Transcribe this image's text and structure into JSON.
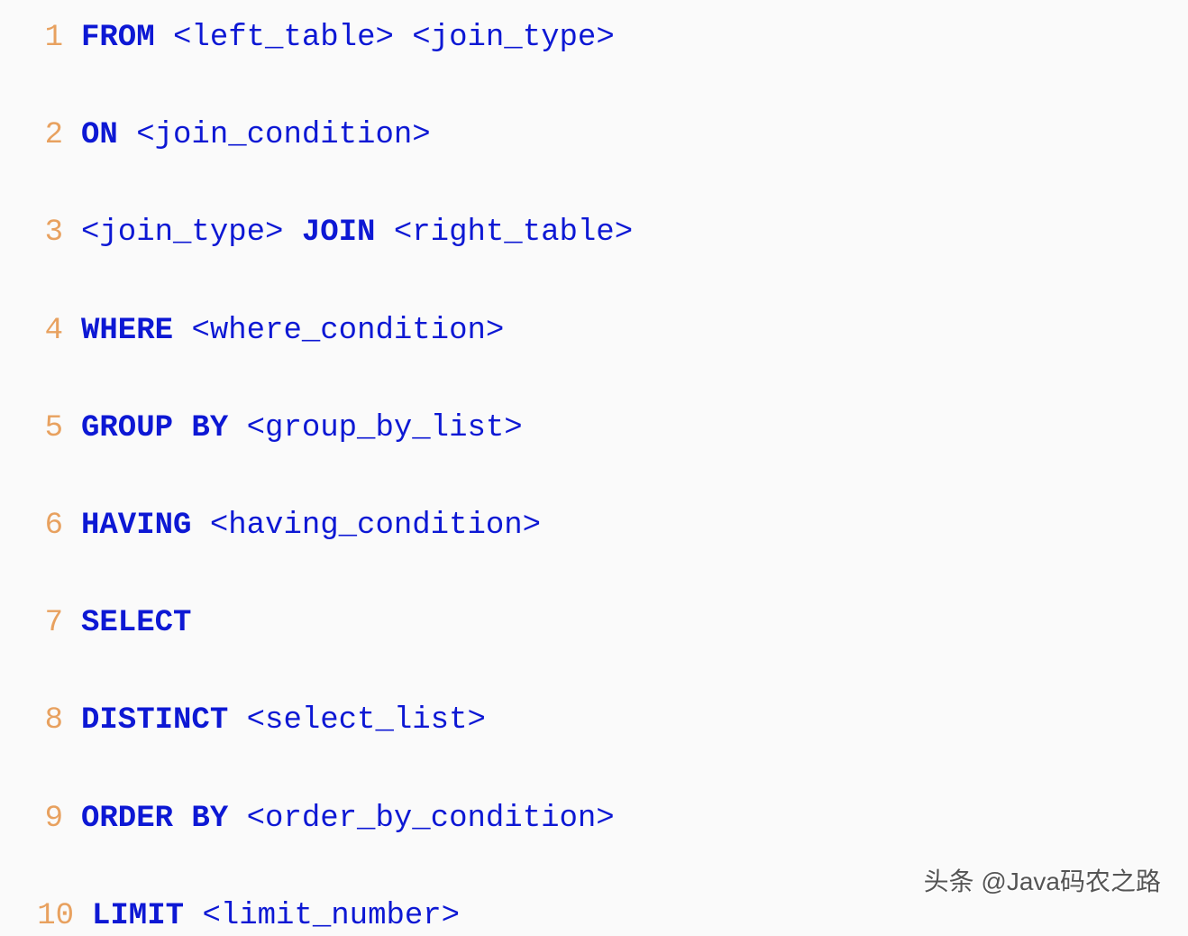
{
  "code": {
    "lines": [
      {
        "number": "1",
        "tokens": [
          {
            "type": "keyword",
            "text": "FROM"
          },
          {
            "type": "space",
            "text": " "
          },
          {
            "type": "placeholder",
            "text": "<left_table>"
          },
          {
            "type": "space",
            "text": " "
          },
          {
            "type": "placeholder",
            "text": "<join_type>"
          }
        ]
      },
      {
        "number": "2",
        "tokens": [
          {
            "type": "keyword",
            "text": "ON"
          },
          {
            "type": "space",
            "text": " "
          },
          {
            "type": "placeholder",
            "text": "<join_condition>"
          }
        ]
      },
      {
        "number": "3",
        "tokens": [
          {
            "type": "placeholder",
            "text": "<join_type>"
          },
          {
            "type": "space",
            "text": " "
          },
          {
            "type": "keyword",
            "text": "JOIN"
          },
          {
            "type": "space",
            "text": " "
          },
          {
            "type": "placeholder",
            "text": "<right_table>"
          }
        ]
      },
      {
        "number": "4",
        "tokens": [
          {
            "type": "keyword",
            "text": "WHERE"
          },
          {
            "type": "space",
            "text": " "
          },
          {
            "type": "placeholder",
            "text": "<where_condition>"
          }
        ]
      },
      {
        "number": "5",
        "tokens": [
          {
            "type": "keyword",
            "text": "GROUP BY"
          },
          {
            "type": "space",
            "text": " "
          },
          {
            "type": "placeholder",
            "text": "<group_by_list>"
          }
        ]
      },
      {
        "number": "6",
        "tokens": [
          {
            "type": "keyword",
            "text": "HAVING"
          },
          {
            "type": "space",
            "text": " "
          },
          {
            "type": "placeholder",
            "text": "<having_condition>"
          }
        ]
      },
      {
        "number": "7",
        "tokens": [
          {
            "type": "keyword",
            "text": "SELECT"
          }
        ]
      },
      {
        "number": "8",
        "tokens": [
          {
            "type": "keyword",
            "text": "DISTINCT"
          },
          {
            "type": "space",
            "text": " "
          },
          {
            "type": "placeholder",
            "text": "<select_list>"
          }
        ]
      },
      {
        "number": "9",
        "tokens": [
          {
            "type": "keyword",
            "text": "ORDER BY"
          },
          {
            "type": "space",
            "text": " "
          },
          {
            "type": "placeholder",
            "text": "<order_by_condition>"
          }
        ]
      },
      {
        "number": "10",
        "tokens": [
          {
            "type": "keyword",
            "text": "LIMIT"
          },
          {
            "type": "space",
            "text": " "
          },
          {
            "type": "placeholder",
            "text": "<limit_number>"
          }
        ]
      }
    ]
  },
  "watermark": "头条 @Java码农之路"
}
